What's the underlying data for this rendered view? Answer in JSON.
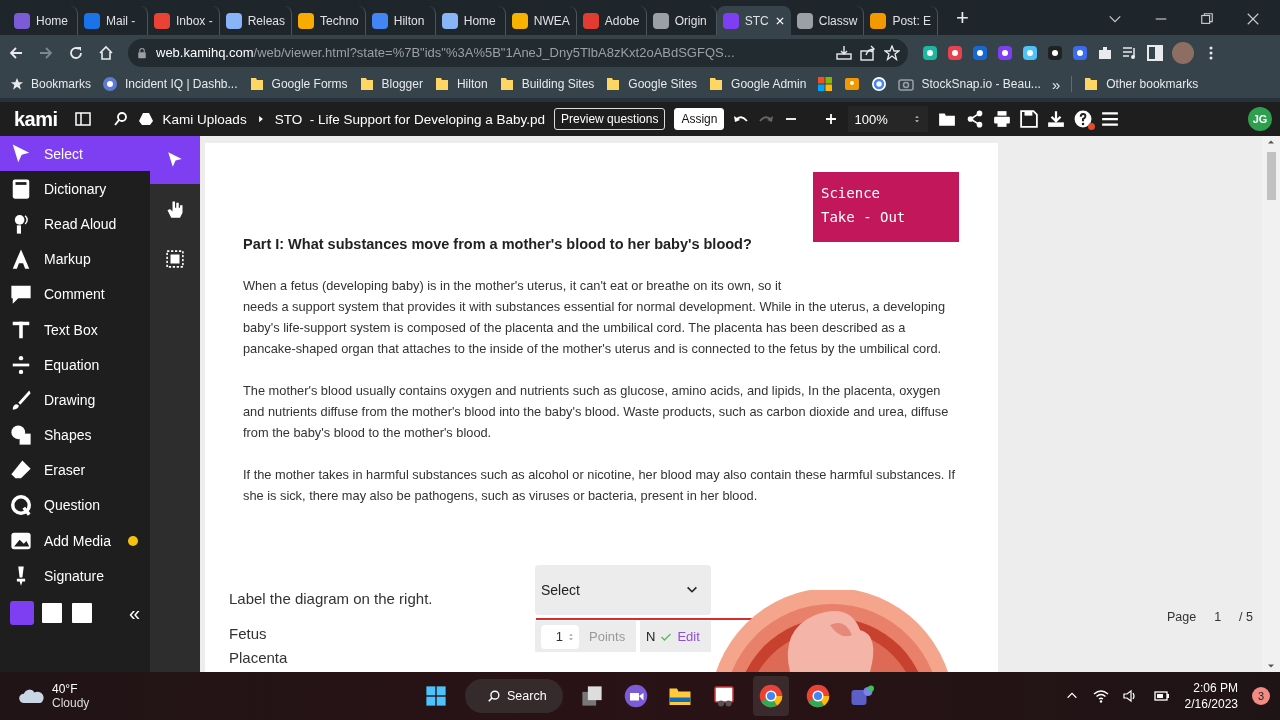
{
  "browser": {
    "tabs": [
      {
        "title": "Home",
        "color": "#7b5cd6",
        "selected": false
      },
      {
        "title": "Mail -",
        "color": "#1a73e8",
        "selected": false
      },
      {
        "title": "Inbox -",
        "color": "#ea4335",
        "selected": false
      },
      {
        "title": "Releas",
        "color": "#8ab4f8",
        "selected": false
      },
      {
        "title": "Techno",
        "color": "#f9ab00",
        "selected": false
      },
      {
        "title": "Hilton",
        "color": "#4285f4",
        "selected": false
      },
      {
        "title": "Home",
        "color": "#8ab4f8",
        "selected": false
      },
      {
        "title": "NWEA",
        "color": "#f6b400",
        "selected": false
      },
      {
        "title": "Adobe",
        "color": "#e03c31",
        "selected": false
      },
      {
        "title": "Origin",
        "color": "#9aa0a6",
        "selected": false
      },
      {
        "title": "STC",
        "color": "#7e3ff2",
        "selected": true
      },
      {
        "title": "Classw",
        "color": "#9aa0a6",
        "selected": false
      },
      {
        "title": "Post: E",
        "color": "#f29900",
        "selected": false
      }
    ],
    "new_tab": "+",
    "address": {
      "host": "web.kamihq.com",
      "path": "/web/viewer.html?state=%7B\"ids\"%3A%5B\"1AneJ_Dny5TlbA8zKxt2oABdSGFQS..."
    },
    "bookmarks": [
      {
        "kind": "star",
        "label": "Bookmarks"
      },
      {
        "kind": "site",
        "label": "Incident IQ | Dashb..."
      },
      {
        "kind": "folder",
        "label": "Google Forms"
      },
      {
        "kind": "folder",
        "label": "Blogger"
      },
      {
        "kind": "folder",
        "label": "Hilton"
      },
      {
        "kind": "folder",
        "label": "Building Sites"
      },
      {
        "kind": "folder",
        "label": "Google Sites"
      },
      {
        "kind": "folder",
        "label": "Google Admin"
      },
      {
        "kind": "tiles"
      },
      {
        "kind": "app"
      },
      {
        "kind": "search"
      },
      {
        "kind": "camera",
        "label": "StockSnap.io - Beau..."
      }
    ],
    "overflow": "»",
    "other_bookmarks": "Other bookmarks"
  },
  "kami": {
    "logo": "kami",
    "breadcrumb": [
      "Kami Uploads",
      "STO  - Life Support for Developing a Baby.pd"
    ],
    "buttons": [
      "Preview questions",
      "Assign"
    ],
    "zoom": "100%",
    "avatar": "JG"
  },
  "sidebar": {
    "tools": [
      {
        "label": "Select",
        "selected": true,
        "dot": false
      },
      {
        "label": "Dictionary",
        "selected": false,
        "dot": false
      },
      {
        "label": "Read Aloud",
        "selected": false,
        "dot": false
      },
      {
        "label": "Markup",
        "selected": false,
        "dot": false
      },
      {
        "label": "Comment",
        "selected": false,
        "dot": false
      },
      {
        "label": "Text Box",
        "selected": false,
        "dot": false
      },
      {
        "label": "Equation",
        "selected": false,
        "dot": false
      },
      {
        "label": "Drawing",
        "selected": false,
        "dot": false
      },
      {
        "label": "Shapes",
        "selected": false,
        "dot": false
      },
      {
        "label": "Eraser",
        "selected": false,
        "dot": false
      },
      {
        "label": "Question",
        "selected": false,
        "dot": false
      },
      {
        "label": "Add Media",
        "selected": false,
        "dot": true
      },
      {
        "label": "Signature",
        "selected": false,
        "dot": false
      }
    ],
    "collapse": "«",
    "modes": [
      {
        "selected": true
      },
      {
        "selected": false
      },
      {
        "selected": false
      }
    ]
  },
  "document": {
    "badge": [
      "Science",
      "Take - Out"
    ],
    "heading": "Part I: What substances move from a mother's blood to her baby's blood?",
    "paragraphs": [
      "When a fetus (developing baby) is in the mother's uterus, it can't eat or breathe on its own, so it\nneeds a support system that provides it with substances essential for normal development. While in the uterus, a developing baby's life-support system is composed of the placenta and the umbilical cord. The placenta has been described as a pancake-shaped organ that attaches to the inside of the mother's uterus and is connected to the fetus by the umbilical cord.",
      "The mother's blood usually contains oxygen and nutrients such as glucose, amino acids, and lipids, In the placenta, oxygen and nutrients diffuse from the mother's blood into the baby's blood. Waste products, such as carbon dioxide and urea, diffuse from the baby's blood to the mother's blood.",
      "If the mother takes in harmful substances such as alcohol or nicotine, her blood may also contain these harmful substances. If she is sick, there may also be pathogens, such as viruses or bacteria, present in her blood."
    ],
    "question": {
      "prompt": "Label the diagram on the right.",
      "select": "Select",
      "points_value": "1",
      "points_label": "Points",
      "cut": "N",
      "edit": "Edit"
    },
    "labels": [
      "Fetus",
      "Placenta"
    ]
  },
  "page_indicator": {
    "label": "Page",
    "current": "1",
    "total": "/ 5"
  },
  "taskbar": {
    "weather": {
      "temp": "40°F",
      "condition": "Cloudy"
    },
    "search": "Search",
    "time": "2:06 PM",
    "date": "2/16/2023",
    "notifications": "3"
  }
}
